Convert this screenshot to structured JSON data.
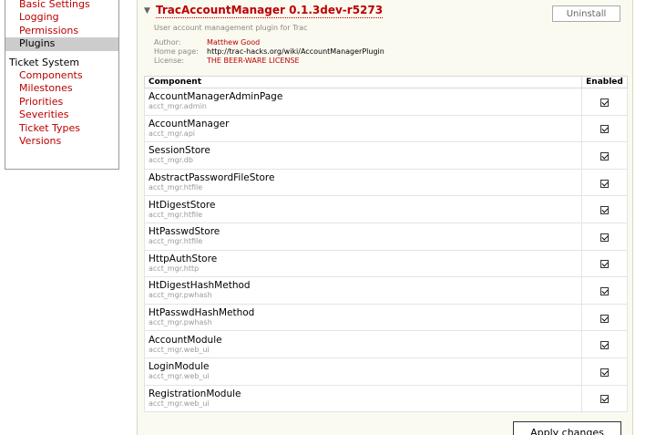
{
  "sidebar": {
    "top_items": [
      {
        "label": "Basic Settings",
        "active": false
      },
      {
        "label": "Logging",
        "active": false
      },
      {
        "label": "Permissions",
        "active": false
      },
      {
        "label": "Plugins",
        "active": true
      }
    ],
    "ticket_heading": "Ticket System",
    "ticket_items": [
      {
        "label": "Components"
      },
      {
        "label": "Milestones"
      },
      {
        "label": "Priorities"
      },
      {
        "label": "Severities"
      },
      {
        "label": "Ticket Types"
      },
      {
        "label": "Versions"
      }
    ]
  },
  "plugin": {
    "title": "TracAccountManager 0.1.3dev-r5273",
    "description": "User account management plugin for Trac",
    "uninstall_label": "Uninstall",
    "author_label": "Author:",
    "author": "Matthew Good",
    "homepage_label": "Home page:",
    "homepage": "http://trac-hacks.org/wiki/AccountManagerPlugin",
    "license_label": "License:",
    "license": "THE BEER-WARE LICENSE",
    "col_component": "Component",
    "col_enabled": "Enabled",
    "apply_label": "Apply changes",
    "components": [
      {
        "name": "AccountManagerAdminPage",
        "module": "acct_mgr.admin",
        "enabled": true
      },
      {
        "name": "AccountManager",
        "module": "acct_mgr.api",
        "enabled": true
      },
      {
        "name": "SessionStore",
        "module": "acct_mgr.db",
        "enabled": true
      },
      {
        "name": "AbstractPasswordFileStore",
        "module": "acct_mgr.htfile",
        "enabled": true
      },
      {
        "name": "HtDigestStore",
        "module": "acct_mgr.htfile",
        "enabled": true
      },
      {
        "name": "HtPasswdStore",
        "module": "acct_mgr.htfile",
        "enabled": true
      },
      {
        "name": "HttpAuthStore",
        "module": "acct_mgr.http",
        "enabled": true
      },
      {
        "name": "HtDigestHashMethod",
        "module": "acct_mgr.pwhash",
        "enabled": true
      },
      {
        "name": "HtPasswdHashMethod",
        "module": "acct_mgr.pwhash",
        "enabled": true
      },
      {
        "name": "AccountModule",
        "module": "acct_mgr.web_ui",
        "enabled": true
      },
      {
        "name": "LoginModule",
        "module": "acct_mgr.web_ui",
        "enabled": true
      },
      {
        "name": "RegistrationModule",
        "module": "acct_mgr.web_ui",
        "enabled": true
      }
    ]
  }
}
